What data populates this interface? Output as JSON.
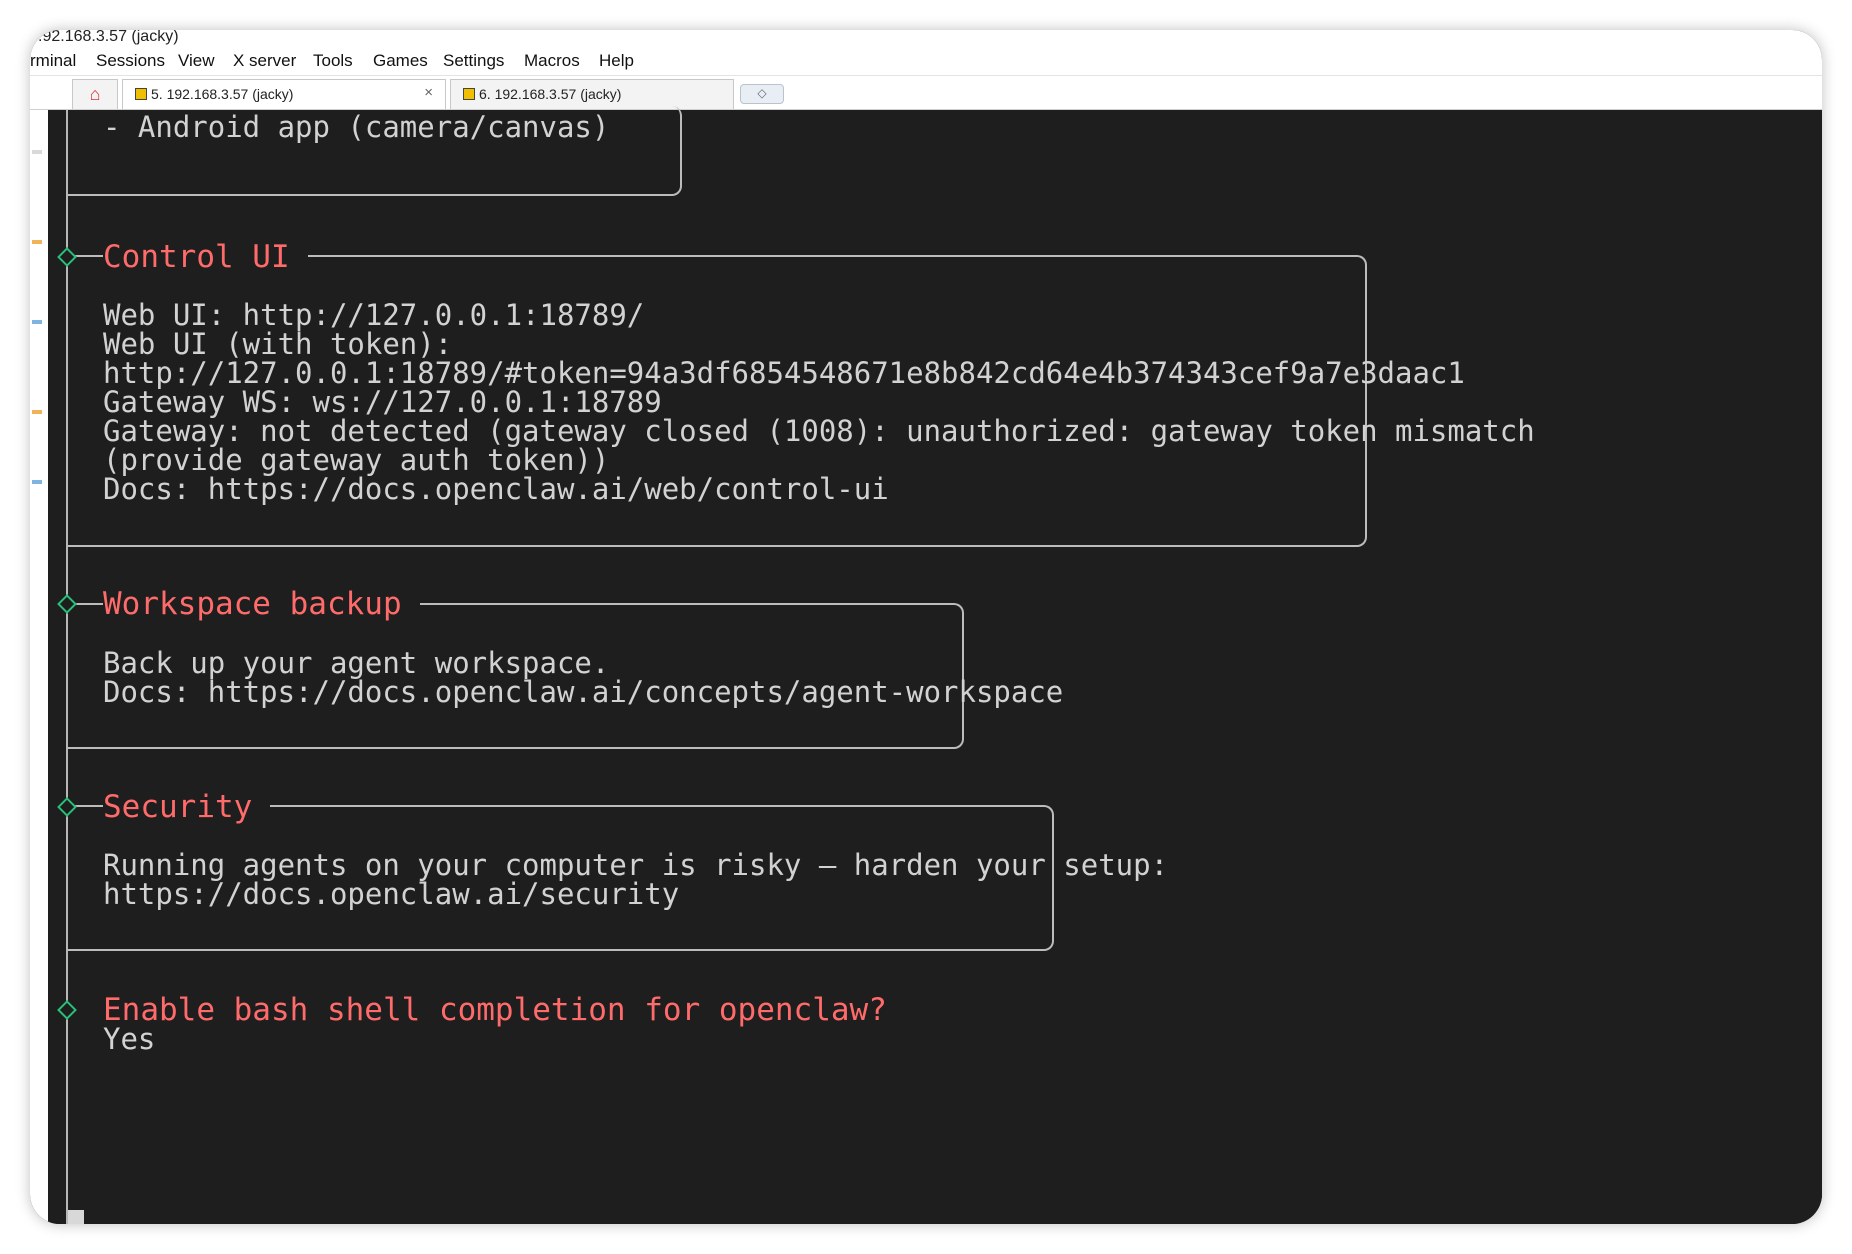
{
  "window": {
    "title": ".92.168.3.57 (jacky)"
  },
  "menu": [
    "rminal",
    "Sessions",
    "View",
    "X server",
    "Tools",
    "Games",
    "Settings",
    "Macros",
    "Help"
  ],
  "tabs": [
    {
      "label": "5. 192.168.3.57 (jacky)",
      "close": "×",
      "active": true
    },
    {
      "label": "6. 192.168.3.57 (jacky)",
      "close": "",
      "active": false
    }
  ],
  "icons": {
    "home": "home-icon",
    "tab": "terminal-icon",
    "close": "close-icon",
    "new_tab": "plus-icon",
    "step_marker": "diamond-icon"
  },
  "colors": {
    "heading": "#ff6b6b",
    "marker": "#29c07a",
    "text": "#d2d2d2",
    "background": "#1e1e1e"
  },
  "terminal": {
    "prev_section_tail": "- Android app (camera/canvas)",
    "sections": [
      {
        "heading": "Control UI",
        "lines": [
          "Web UI: http://127.0.0.1:18789/",
          "Web UI (with token):",
          "http://127.0.0.1:18789/#token=94a3df6854548671e8b842cd64e4b374343cef9a7e3daac1",
          "Gateway WS: ws://127.0.0.1:18789",
          "Gateway: not detected (gateway closed (1008): unauthorized: gateway token mismatch",
          "(provide gateway auth token))",
          "Docs: https://docs.openclaw.ai/web/control-ui"
        ]
      },
      {
        "heading": "Workspace backup",
        "lines": [
          "Back up your agent workspace.",
          "Docs: https://docs.openclaw.ai/concepts/agent-workspace"
        ]
      },
      {
        "heading": "Security",
        "lines": [
          "Running agents on your computer is risky — harden your setup:",
          "https://docs.openclaw.ai/security"
        ]
      }
    ],
    "prompt": {
      "question": "Enable bash shell completion for openclaw?",
      "answer": "Yes"
    }
  }
}
